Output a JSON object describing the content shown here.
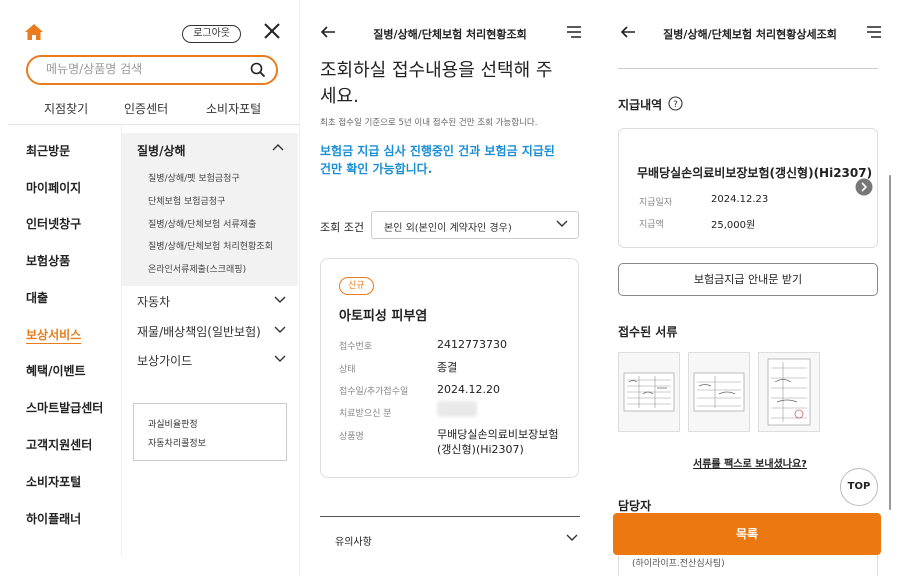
{
  "colors": {
    "accent": "#e87c1e",
    "link_blue": "#1b8fd6",
    "button_orange": "#ec7812"
  },
  "menu_screen": {
    "logout_label": "로그아웃",
    "search_placeholder": "메뉴명/상품명 검색",
    "quick_links": [
      "지점찾기",
      "인증센터",
      "소비자포털"
    ],
    "left_items": [
      "최근방문",
      "마이페이지",
      "인터넷창구",
      "보험상품",
      "대출",
      "보상서비스",
      "혜택/이벤트",
      "스마트발급센터",
      "고객지원센터",
      "소비자포털",
      "하이플래너"
    ],
    "active_left": "보상서비스",
    "open_category": "질병/상해",
    "sub_items": [
      "질병/상해/펫 보험금청구",
      "단체보험 보험금청구",
      "질병/상해/단체보험 서류제출",
      "질병/상해/단체보험 처리현황조회",
      "온라인서류제출(스크래핑)"
    ],
    "categories": [
      "자동차",
      "재물/배상책임(일반보험)",
      "보상가이드"
    ],
    "side_links": [
      "과실비율판정",
      "자동차리콜정보"
    ]
  },
  "status_screen": {
    "title": "질병/상해/단체보험 처리현황조회",
    "heading": "조회하실 접수내용을 선택해 주세요.",
    "note": "최초 접수일 기준으로 5년 이내 접수된 건만 조회 가능합니다.",
    "blue_notice": "보험금 지급 심사 진행중인 건과 보험금 지급된 건만 확인 가능합니다.",
    "condition_label": "조회 조건",
    "condition_value": "본인 외(본인이 계약자인 경우)",
    "card": {
      "badge": "신규",
      "title": "아토피성 피부염",
      "rows": [
        {
          "label": "접수번호",
          "value": "2412773730"
        },
        {
          "label": "상태",
          "value": "종결"
        },
        {
          "label": "접수일/추가접수일",
          "value": "2024.12.20"
        },
        {
          "label": "치료받으신 분",
          "value": ""
        },
        {
          "label": "상품명",
          "value": "무배당실손의료비보장보험(갱신형)(Hi2307)"
        }
      ]
    },
    "notice_label": "유의사항"
  },
  "detail_screen": {
    "title": "질병/상해/단체보험 처리현황상세조회",
    "payment_section": "지급내역",
    "payment": {
      "product": "무배당실손의료비보장보험(갱신형)(Hi2307)",
      "date_label": "지급일자",
      "date": "2024.12.23",
      "amount_label": "지급액",
      "amount": "25,000원"
    },
    "guide_button": "보험금지급 안내문 받기",
    "docs_section": "접수된 서류",
    "fax_link": "서류를 팩스로 보내셨나요?",
    "top_label": "TOP",
    "manager_section": "담당자",
    "list_button": "목록",
    "manager_peek": "(하이라이프.전산심사팀)"
  }
}
